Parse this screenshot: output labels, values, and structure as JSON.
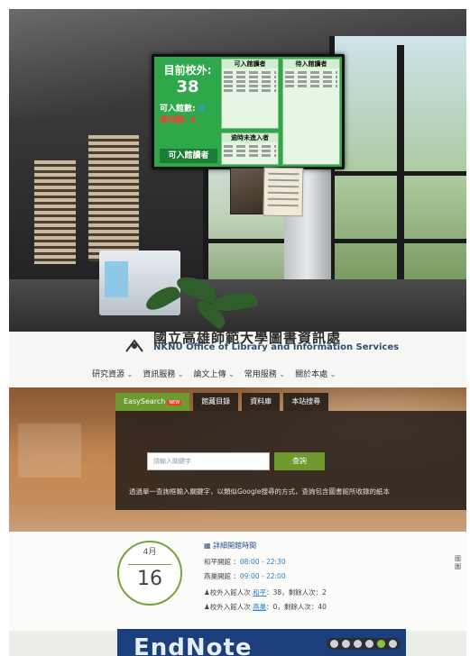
{
  "display": {
    "title": "目前校外:",
    "count": "38",
    "enter_label": "可入館數:",
    "enter_value": "0",
    "wait_label": "等待數:",
    "wait_value": "4",
    "button": "可入館讀者",
    "panel1_title": "可入館讀者",
    "panel2_title": "待入館讀者",
    "panel3_title": "逾時未進入者"
  },
  "site": {
    "name_zh": "國立高雄師範大學圖書資訊處",
    "name_en": "NKNU Office of Library and Information Services",
    "nav": [
      "研究資源",
      "資訊服務",
      "論文上傳",
      "常用服務",
      "關於本處"
    ],
    "tabs": [
      "EasySearch",
      "館藏目錄",
      "資料庫",
      "本站搜尋"
    ],
    "new_badge": "NEW",
    "search_placeholder": "請輸入關鍵字",
    "search_button": "查詢",
    "search_desc": "透過單一查詢框輸入關鍵字，以類似Google搜尋的方式，查詢包含圖書館所收錄的紙本",
    "date_month": "4月",
    "date_day": "16",
    "hours_title": "詳細開館時間",
    "hours": [
      {
        "label": "和平開館",
        "time": "08:00 - 22:30"
      },
      {
        "label": "燕巢開館",
        "time": "09:00 - 22:00"
      }
    ],
    "visitors": [
      {
        "prefix": "校外入館人次",
        "campus": "和平",
        "count": "38",
        "remain_label": "剩餘人次",
        "remain": "2"
      },
      {
        "prefix": "校外入館人次",
        "campus": "燕巢",
        "count": "0",
        "remain_label": "剩餘人次",
        "remain": "40"
      }
    ],
    "side_tag": "國\n圖",
    "banner_text": "EndNote"
  }
}
